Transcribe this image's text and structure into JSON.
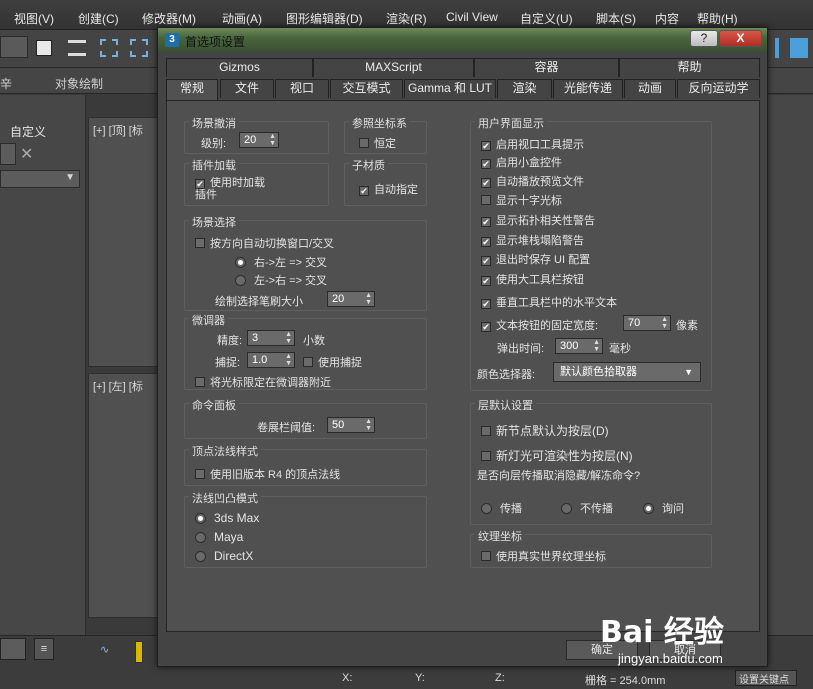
{
  "menubar": {
    "items": [
      "视图(V)",
      "创建(C)",
      "修改器(M)",
      "动画(A)",
      "图形编辑器(D)",
      "渲染(R)",
      "Civil View",
      "自定义(U)",
      "脚本(S)",
      "内容",
      "帮助(H)"
    ]
  },
  "ribbon": {
    "tab_partial": "辛",
    "object_paint": "对象绘制"
  },
  "leftpanel": {
    "custom_label": "自定义"
  },
  "viewports": {
    "top_label": "[+] [顶] [标",
    "left_label": "[+] [左] [标"
  },
  "bottombar": {
    "grid": "栅格 = 254.0mm",
    "set_key": "设置关键点",
    "x_label": "X:",
    "y_label": "Y:",
    "z_label": "Z:",
    "frame": "0"
  },
  "dialog": {
    "title": "首选项设置",
    "app_icon": "3",
    "help_button": "?",
    "close_button": "X",
    "tabs_row1": [
      "Gizmos",
      "MAXScript",
      "容器",
      "帮助"
    ],
    "tabs_row2": [
      "常规",
      "文件",
      "视口",
      "交互模式",
      "Gamma 和 LUT",
      "渲染",
      "光能传递",
      "动画",
      "反向运动学"
    ],
    "scene_undo": {
      "title": "场景撤消",
      "levels_label": "级别:",
      "levels_value": "20"
    },
    "ref_coord": {
      "title": "参照坐标系",
      "constant_label": "恒定"
    },
    "plugin_load": {
      "title": "插件加载",
      "load_on_use_label": "使用时加载插件"
    },
    "sub_material": {
      "title": "子材质",
      "auto_assign_label": "自动指定"
    },
    "scene_selection": {
      "title": "场景选择",
      "auto_window_label": "按方向自动切换窗口/交叉",
      "right_left_label": "右->左 => 交叉",
      "left_right_label": "左->右 => 交叉",
      "paint_brush_label": "绘制选择笔刷大小",
      "paint_brush_value": "20"
    },
    "spinners": {
      "title": "微调器",
      "precision_label": "精度:",
      "precision_value": "3",
      "decimals_label": "小数",
      "snap_label": "捕捉:",
      "snap_value": "1.0",
      "use_snap_label": "使用捕捉",
      "wrap_cursor_label": "将光标限定在微调器附近"
    },
    "command_panel": {
      "title": "命令面板",
      "rollup_label": "卷展栏阈值:",
      "rollup_value": "50"
    },
    "vertex_normal": {
      "title": "顶点法线样式",
      "legacy_label": "使用旧版本 R4 的顶点法线"
    },
    "normal_bump": {
      "title": "法线凹凸模式",
      "options": [
        "3ds Max",
        "Maya",
        "DirectX"
      ]
    },
    "ui_display": {
      "title": "用户界面显示",
      "checks": [
        "启用视口工具提示",
        "启用小盒控件",
        "自动播放预览文件",
        "显示十字光标",
        "显示拓扑相关性警告",
        "显示堆栈塌陷警告",
        "退出时保存 UI 配置",
        "使用大工具栏按钮",
        "垂直工具栏中的水平文本"
      ],
      "fixed_width_label": "文本按钮的固定宽度:",
      "fixed_width_value": "70",
      "fixed_width_unit": "像素",
      "flyout_label": "弹出时间:",
      "flyout_value": "300",
      "flyout_unit": "毫秒",
      "color_picker_label": "颜色选择器:",
      "color_picker_value": "默认颜色拾取器"
    },
    "layer_defaults": {
      "title": "层默认设置",
      "new_nodes_label": "新节点默认为按层(D)",
      "new_lights_label": "新灯光可渲染性为按层(N)",
      "propagate_question": "是否向层传播取消隐藏/解冻命令?",
      "propagate_options": [
        "传播",
        "不传播",
        "询问"
      ]
    },
    "texture_coords": {
      "title": "纹理坐标",
      "real_world_label": "使用真实世界纹理坐标"
    },
    "ok_button": "确定",
    "cancel_button": "取消"
  },
  "watermark": {
    "brand": "Bai 经验",
    "url": "jingyan.baidu.com"
  }
}
